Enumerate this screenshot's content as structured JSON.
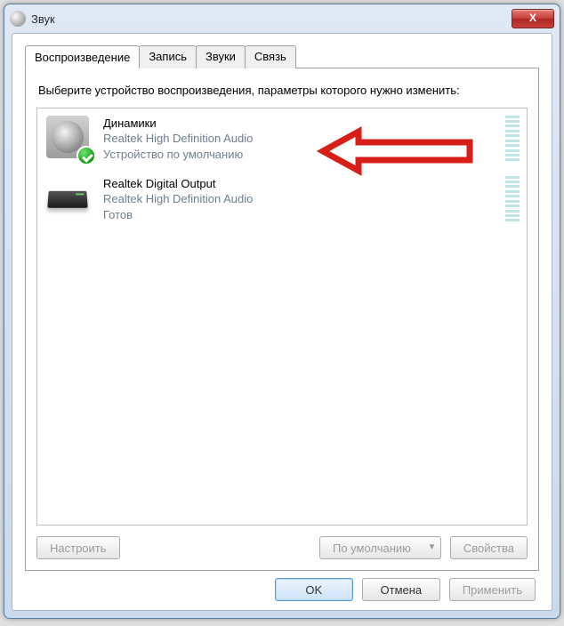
{
  "window": {
    "title": "Звук"
  },
  "tabs": [
    {
      "label": "Воспроизведение",
      "active": true
    },
    {
      "label": "Запись",
      "active": false
    },
    {
      "label": "Звуки",
      "active": false
    },
    {
      "label": "Связь",
      "active": false
    }
  ],
  "instruction": "Выберите устройство воспроизведения, параметры которого нужно изменить:",
  "devices": [
    {
      "title": "Динамики",
      "driver": "Realtek High Definition Audio",
      "status": "Устройство по умолчанию",
      "icon": "speaker",
      "default": true
    },
    {
      "title": "Realtek Digital Output",
      "driver": "Realtek High Definition Audio",
      "status": "Готов",
      "icon": "digital",
      "default": false
    }
  ],
  "panel_buttons": {
    "configure": "Настроить",
    "set_default": "По умолчанию",
    "properties": "Свойства"
  },
  "dialog_buttons": {
    "ok": "OK",
    "cancel": "Отмена",
    "apply": "Применить"
  },
  "annotation": {
    "color": "#d81e18",
    "points_to_device_index": 0
  }
}
